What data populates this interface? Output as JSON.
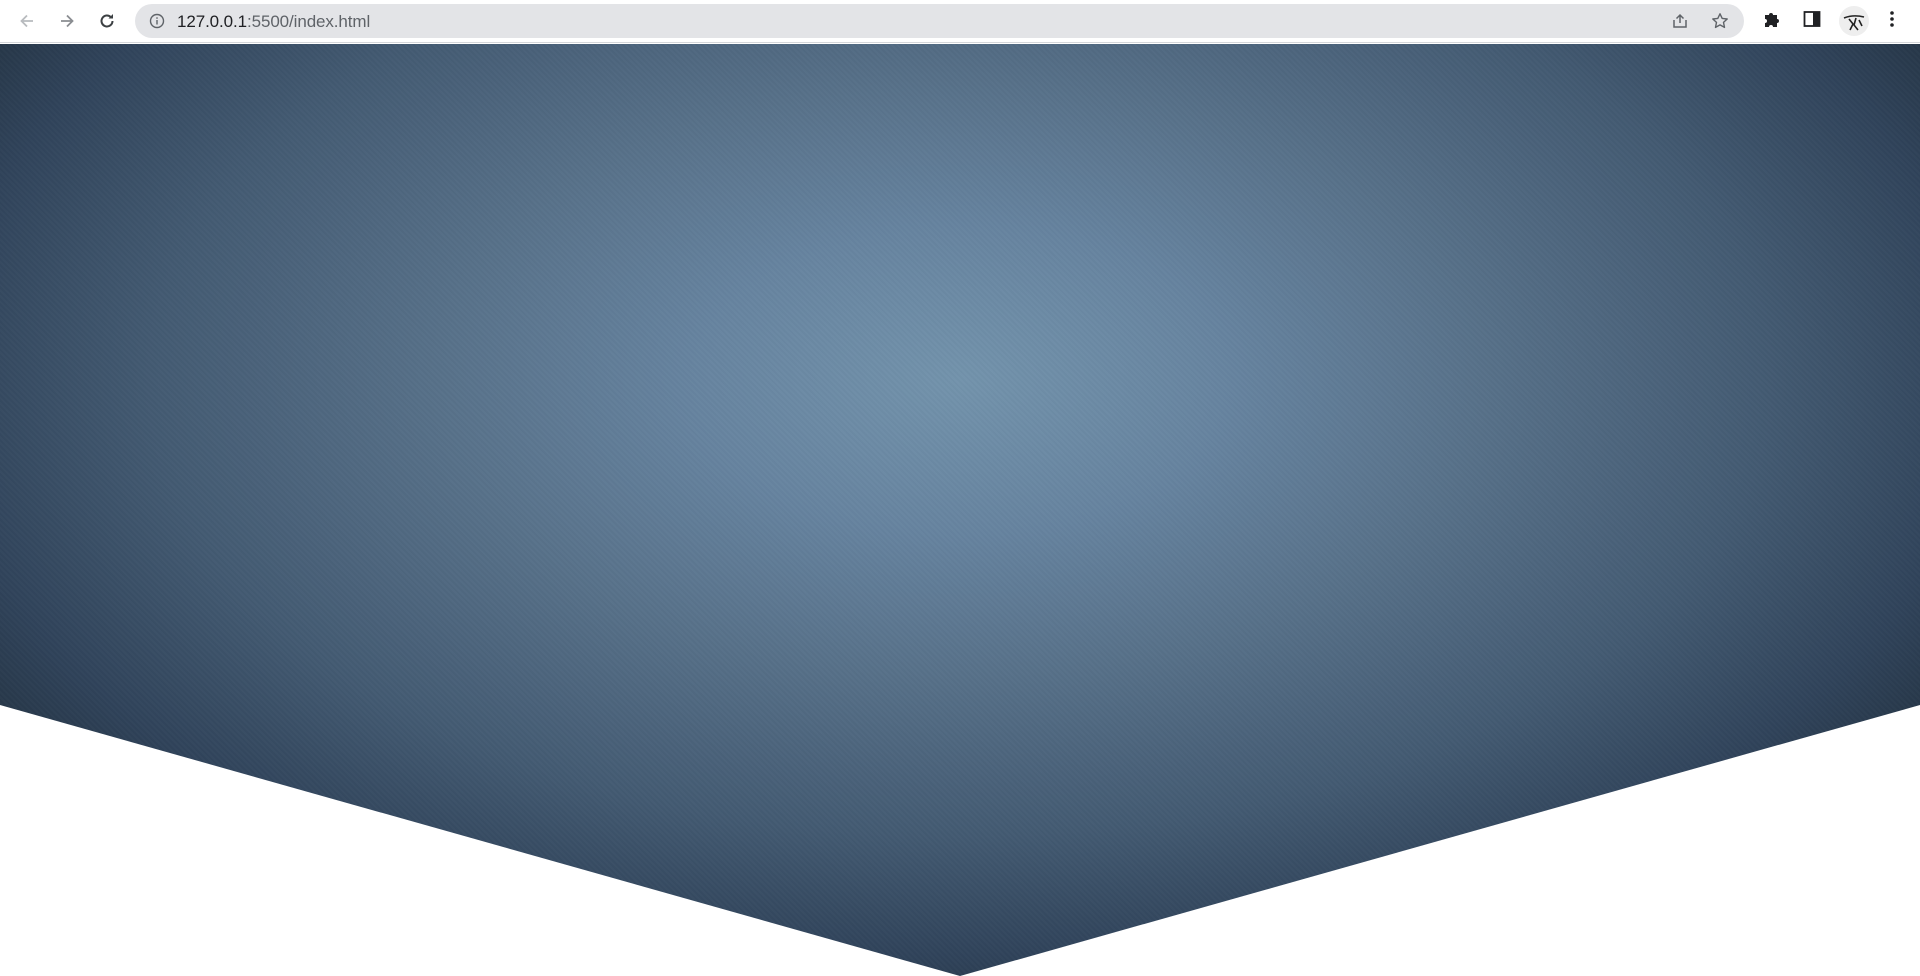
{
  "browser": {
    "url_host": "127.0.0.1",
    "url_path": ":5500/index.html",
    "icons": {
      "back": "back-arrow-icon",
      "forward": "forward-arrow-icon",
      "reload": "reload-icon",
      "site_info": "info-icon",
      "share": "share-icon",
      "bookmark": "star-icon",
      "extensions": "puzzle-icon",
      "side_panel": "side-panel-icon",
      "menu": "kebab-menu-icon"
    }
  },
  "page": {
    "hero_colors": {
      "center": "#7393ac",
      "edge": "#22313f"
    },
    "background": "#ffffff"
  }
}
